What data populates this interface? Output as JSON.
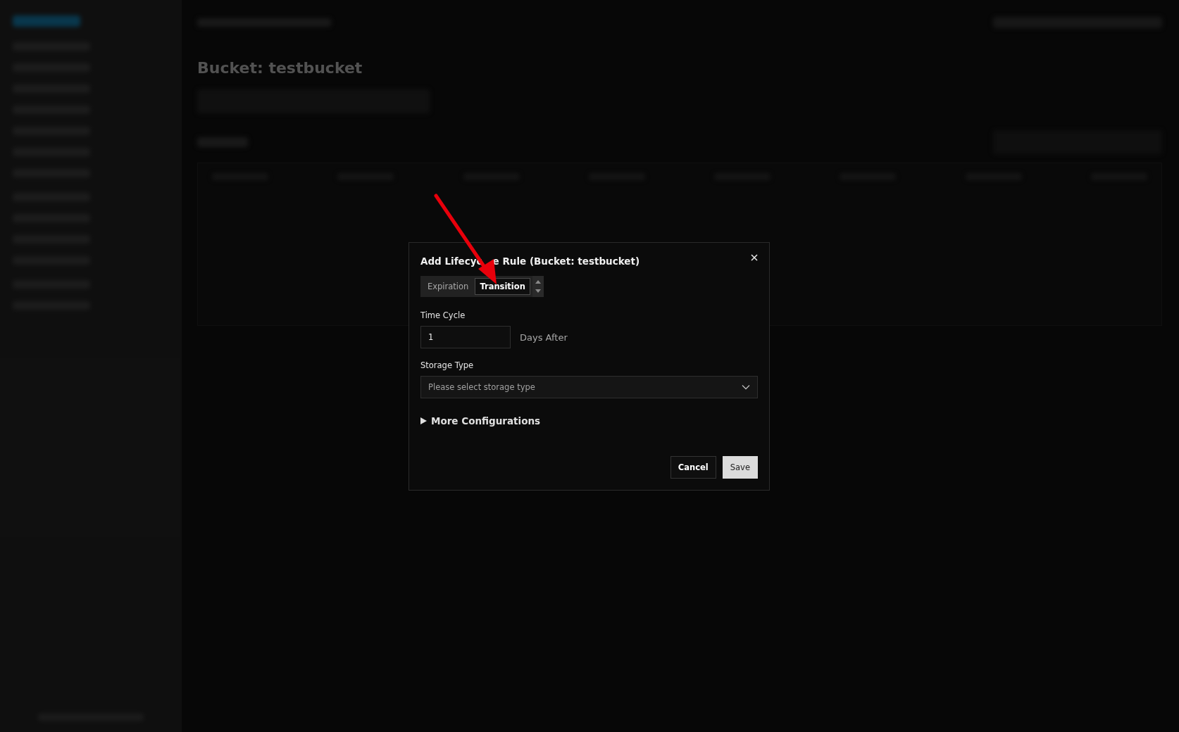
{
  "page": {
    "title": "Bucket: testbucket"
  },
  "dialog": {
    "title_parts": [
      "Add Lifecyc",
      "e Rule (Bucket: testbucket)"
    ],
    "tabs": [
      {
        "label": "Expiration",
        "selected": false
      },
      {
        "label": "Transition",
        "selected": true
      }
    ],
    "time_cycle": {
      "label": "Time Cycle",
      "value": "1",
      "unit": "Days After"
    },
    "storage_type": {
      "label": "Storage Type",
      "placeholder": "Please select storage type"
    },
    "more_configurations": {
      "label": "More Configurations",
      "expanded": false
    },
    "buttons": [
      {
        "label": "Cancel",
        "kind": "secondary"
      },
      {
        "label": "Save",
        "kind": "primary"
      }
    ]
  }
}
